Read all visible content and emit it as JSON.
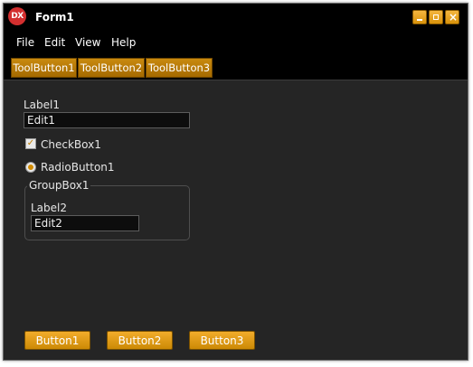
{
  "window": {
    "title": "Form1",
    "app_icon_text": "DX"
  },
  "menu": {
    "items": [
      "File",
      "Edit",
      "View",
      "Help"
    ]
  },
  "toolbar": {
    "buttons": [
      "ToolButton1",
      "ToolButton2",
      "ToolButton3"
    ]
  },
  "form": {
    "label1": "Label1",
    "edit1": "Edit1",
    "checkbox1": {
      "label": "CheckBox1",
      "checked": true
    },
    "radio1": {
      "label": "RadioButton1",
      "selected": true
    },
    "groupbox1": {
      "caption": "GroupBox1",
      "label2": "Label2",
      "edit2": "Edit2"
    }
  },
  "buttons": [
    "Button1",
    "Button2",
    "Button3"
  ],
  "colors": {
    "accent": "#e39d19",
    "window_bg": "#000000",
    "client_bg": "#252525",
    "app_icon": "#d32f2f"
  }
}
